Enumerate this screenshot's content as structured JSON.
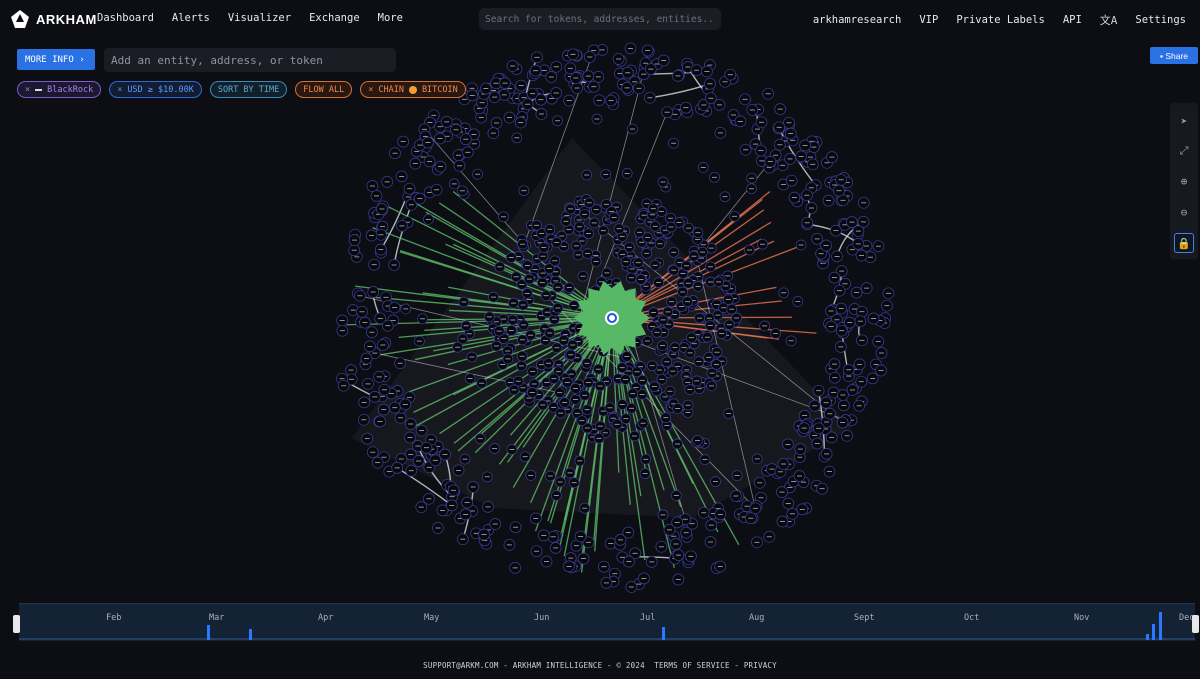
{
  "brand": {
    "name": "ARKHAM"
  },
  "nav": {
    "left": [
      "Dashboard",
      "Alerts",
      "Visualizer",
      "Exchange",
      "More"
    ],
    "right": [
      "arkhamresearch",
      "VIP",
      "Private Labels",
      "API",
      "Settings"
    ],
    "translate_icon": "translate-icon"
  },
  "search": {
    "placeholder": "Search for tokens, addresses, entities..."
  },
  "controls": {
    "more_info": "MORE INFO",
    "entity_placeholder": "Add an entity, address, or token",
    "share": "Share"
  },
  "filters": [
    {
      "label": "BlackRock",
      "style": "purple"
    },
    {
      "label": "USD ≥ $10.00K",
      "style": "blue"
    },
    {
      "label": "SORT BY TIME",
      "style": "teal"
    },
    {
      "label": "FLOW ALL",
      "style": "orange"
    },
    {
      "label": "CHAIN",
      "value": "BITCOIN",
      "style": "orange"
    }
  ],
  "tools": [
    "pointer-icon",
    "fit-icon",
    "zoom-in-icon",
    "zoom-out-icon",
    "lock-icon"
  ],
  "colors": {
    "accent": "#2a71e6",
    "inflow": "#5fbf6a",
    "outflow": "#e0704f",
    "center_node": "#57b866",
    "edge": "#cfd2d8"
  },
  "timeline": {
    "months": [
      "Feb",
      "Mar",
      "Apr",
      "May",
      "Jun",
      "Jul",
      "Aug",
      "Sept",
      "Oct",
      "Nov",
      "Dec"
    ]
  },
  "footer": {
    "support": "SUPPORT@ARKM.COM",
    "company": "ARKHAM INTELLIGENCE",
    "copyright": "© 2024",
    "terms": "TERMS OF SERVICE",
    "privacy": "PRIVACY"
  }
}
